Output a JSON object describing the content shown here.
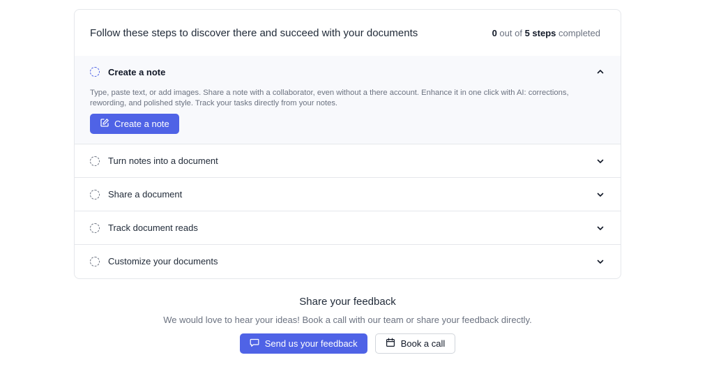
{
  "onboarding": {
    "title": "Follow these steps to discover there and succeed with your documents",
    "progress": {
      "done": "0",
      "out_of": "out of",
      "total": "5 steps",
      "completed": "completed"
    },
    "steps": [
      {
        "label": "Create a note",
        "expanded": true,
        "description": "Type, paste text, or add images. Share a note with a collaborator, even without a there account. Enhance it in one click with AI: corrections, rewording, and polished style. Track your tasks directly from your notes.",
        "action_label": "Create a note",
        "action_icon": "edit-note-icon"
      },
      {
        "label": "Turn notes into a document",
        "expanded": false
      },
      {
        "label": "Share a document",
        "expanded": false
      },
      {
        "label": "Track document reads",
        "expanded": false
      },
      {
        "label": "Customize your documents",
        "expanded": false
      }
    ]
  },
  "feedback": {
    "title": "Share your feedback",
    "subtitle": "We would love to hear your ideas! Book a call with our team or share your feedback directly.",
    "send_label": "Send us your feedback",
    "send_icon": "chat-bubble-icon",
    "book_label": "Book a call",
    "book_icon": "calendar-icon"
  },
  "colors": {
    "accent": "#4f63e6",
    "expanded_bg": "#f8f9fc",
    "border": "#e5e7eb",
    "muted_text": "#6b7280"
  }
}
